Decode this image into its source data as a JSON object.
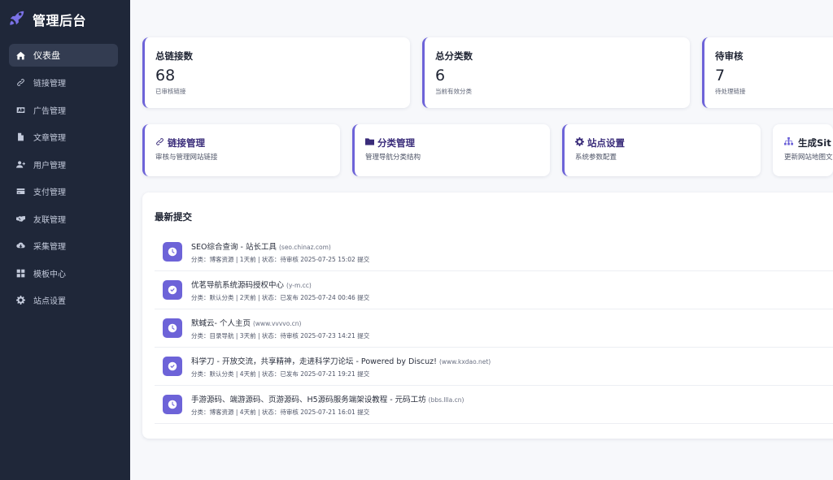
{
  "brand": {
    "title": "管理后台",
    "icon": "rocket-icon",
    "icon_color": "#6d63d8"
  },
  "accent_color": "#6d63d8",
  "sidebar": {
    "items": [
      {
        "label": "仪表盘",
        "icon": "home-icon",
        "active": true
      },
      {
        "label": "链接管理",
        "icon": "link-icon"
      },
      {
        "label": "广告管理",
        "icon": "ad-icon"
      },
      {
        "label": "文章管理",
        "icon": "file-icon"
      },
      {
        "label": "用户管理",
        "icon": "users-icon"
      },
      {
        "label": "支付管理",
        "icon": "credit-card-icon"
      },
      {
        "label": "友联管理",
        "icon": "handshake-icon"
      },
      {
        "label": "采集管理",
        "icon": "cloud-download-icon"
      },
      {
        "label": "模板中心",
        "icon": "grid-icon"
      },
      {
        "label": "站点设置",
        "icon": "gear-icon"
      }
    ]
  },
  "stats": [
    {
      "title": "总链接数",
      "value": "68",
      "sub": "已审核链接"
    },
    {
      "title": "总分类数",
      "value": "6",
      "sub": "当前有效分类"
    },
    {
      "title": "待审核",
      "value": "7",
      "sub": "待处理链接"
    }
  ],
  "actions": [
    {
      "title": "链接管理",
      "sub": "审核与管理网站链接",
      "icon": "link-icon"
    },
    {
      "title": "分类管理",
      "sub": "管理导航分类结构",
      "icon": "folder-icon"
    },
    {
      "title": "站点设置",
      "sub": "系统参数配置",
      "icon": "gear-icon"
    },
    {
      "title": "生成Sit",
      "sub": "更新网站地图文",
      "icon": "sitemap-icon"
    }
  ],
  "latest": {
    "title": "最新提交",
    "items": [
      {
        "name": "SEO综合查询 - 站长工具",
        "domain": "(seo.chinaz.com)",
        "meta": "分类：博客资源 | 1天前 | 状态：待审核 2025-07-25 15:02 提交",
        "status_icon": "clock-icon"
      },
      {
        "name": "优茗导航系统源码授权中心",
        "domain": "(y-m.cc)",
        "meta": "分类：默认分类 | 2天前 | 状态：已发布 2025-07-24 00:46 提交",
        "status_icon": "check-icon"
      },
      {
        "name": "默蜮云- 个人主页",
        "domain": "(www.vvvvo.cn)",
        "meta": "分类：目录导航 | 3天前 | 状态：待审核 2025-07-23 14:21 提交",
        "status_icon": "clock-icon"
      },
      {
        "name": "科学刀 - 开放交流，共享精神，走进科学刀论坛 - Powered by Discuz!",
        "domain": "(www.kxdao.net)",
        "meta": "分类：默认分类 | 4天前 | 状态：已发布 2025-07-21 19:21 提交",
        "status_icon": "check-icon"
      },
      {
        "name": "手游源码、端游源码、页游源码、H5源码服务端架设教程 - 元码工坊",
        "domain": "(bbs.llla.cn)",
        "meta": "分类：博客资源 | 4天前 | 状态：待审核 2025-07-21 16:01 提交",
        "status_icon": "clock-icon"
      }
    ]
  }
}
